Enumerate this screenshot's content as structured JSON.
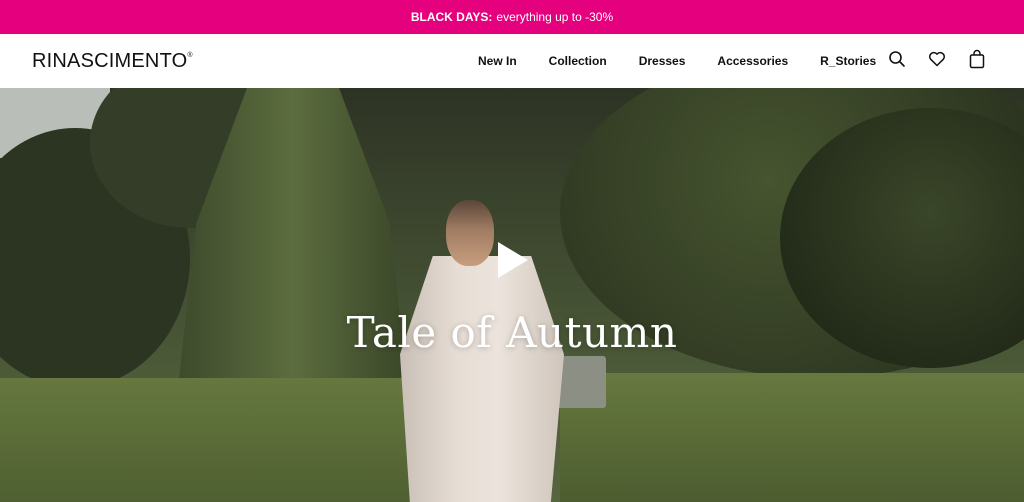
{
  "promo": {
    "highlight": "BLACK DAYS:",
    "text": "everything up to -30%",
    "bg_color": "#e5007e"
  },
  "header": {
    "logo": "RINASCIMENTO",
    "logo_mark": "®",
    "nav": [
      {
        "label": "New In"
      },
      {
        "label": "Collection"
      },
      {
        "label": "Dresses"
      },
      {
        "label": "Accessories"
      },
      {
        "label": "R_Stories"
      }
    ],
    "icons": [
      "search-icon",
      "heart-icon",
      "shopping-bag-icon"
    ]
  },
  "hero": {
    "title": "Tale of Autumn",
    "media": "video"
  }
}
